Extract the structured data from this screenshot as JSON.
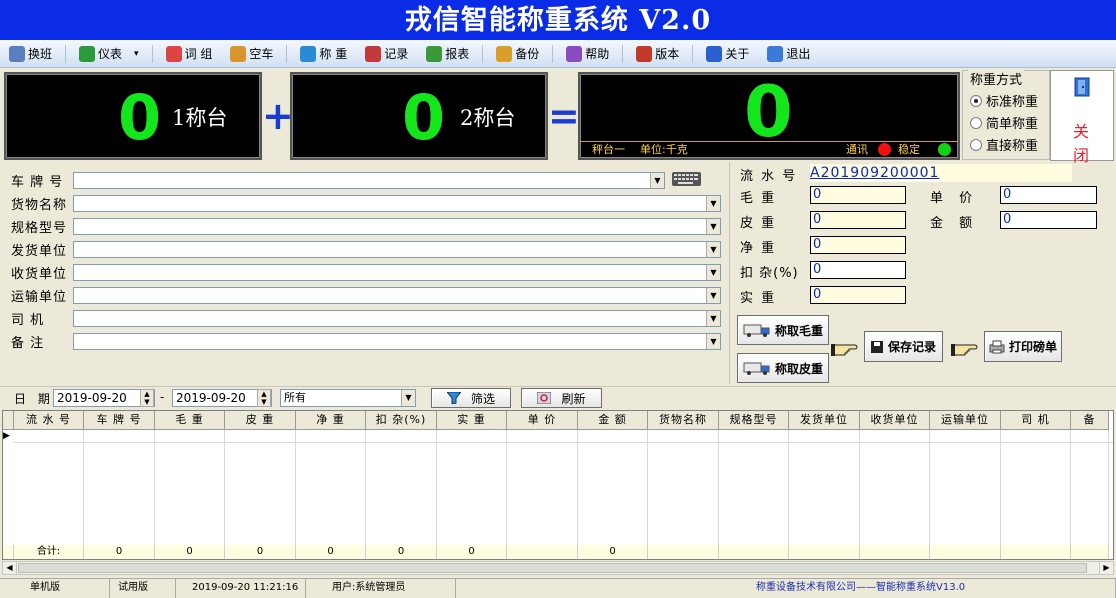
{
  "app": {
    "title": "戎信智能称重系统 V2.0"
  },
  "colors": {
    "title_bg": "#0b2ce6",
    "digit": "#14e61c",
    "accent_blue": "#1a3bd6",
    "close_red": "#e8202a"
  },
  "toolbar": {
    "items": [
      {
        "label": "换班",
        "icon": "user-icon"
      },
      {
        "label": "仪表",
        "icon": "gauge-icon"
      },
      {
        "label": "词 组",
        "icon": "edit-icon"
      },
      {
        "label": "空车",
        "icon": "truck-icon"
      },
      {
        "label": "称 重",
        "icon": "scale-icon"
      },
      {
        "label": "记录",
        "icon": "records-icon"
      },
      {
        "label": "报表",
        "icon": "report-icon"
      },
      {
        "label": "备份",
        "icon": "backup-icon"
      },
      {
        "label": "帮助",
        "icon": "help-icon"
      },
      {
        "label": "版本",
        "icon": "version-icon"
      },
      {
        "label": "关于",
        "icon": "info-icon"
      },
      {
        "label": "退出",
        "icon": "exit-icon"
      }
    ]
  },
  "display": {
    "scale1": {
      "value": "0",
      "label": "1称台"
    },
    "plus": "+",
    "scale2": {
      "value": "0",
      "label": "2称台"
    },
    "equals": "=",
    "total": {
      "value": "0",
      "platform": "秤台一",
      "unit": "单位:千克",
      "comm": "通讯",
      "stable": "稳定",
      "comm_color": "#ee1111",
      "stable_color": "#12d412"
    }
  },
  "weigh_mode": {
    "legend": "称重方式",
    "options": [
      "标准称重",
      "简单称重",
      "直接称重"
    ],
    "selected": "标准称重"
  },
  "close_button": {
    "label": "关闭"
  },
  "form_left": {
    "fields": [
      {
        "label": "车 牌 号",
        "value": ""
      },
      {
        "label": "货物名称",
        "value": ""
      },
      {
        "label": "规格型号",
        "value": ""
      },
      {
        "label": "发货单位",
        "value": ""
      },
      {
        "label": "收货单位",
        "value": ""
      },
      {
        "label": "运输单位",
        "value": ""
      },
      {
        "label": "司   机",
        "value": ""
      },
      {
        "label": "备   注",
        "value": ""
      }
    ]
  },
  "form_right": {
    "serial_label": "流 水 号",
    "serial_value": "A201909200001",
    "gross_label": "毛  重",
    "gross": "0",
    "tare_label": "皮  重",
    "tare": "0",
    "net_label": "净  重",
    "net": "0",
    "deduct_label": "扣 杂(%)",
    "deduct": "0",
    "actual_label": "实  重",
    "actual": "0",
    "price_label": "单  价",
    "price": "0",
    "amount_label": "金  额",
    "amount": "0"
  },
  "actions": {
    "gross_btn": "称取毛重",
    "tare_btn": "称取皮重",
    "save_btn": "保存记录",
    "print_btn": "打印磅单"
  },
  "filter": {
    "date_label": "日 期",
    "date_from": "2019-09-20",
    "dash": "-",
    "date_to": "2019-09-20",
    "select_value": "所有",
    "filter_btn": "筛选",
    "refresh_btn": "刷新"
  },
  "table": {
    "columns": [
      "流 水 号",
      "车 牌 号",
      "毛   重",
      "皮   重",
      "净   重",
      "扣 杂(%)",
      "实   重",
      "单   价",
      "金   额",
      "货物名称",
      "规格型号",
      "发货单位",
      "收货单位",
      "运输单位",
      "司   机",
      "备"
    ],
    "row_marker": "▶",
    "totals": [
      "合计:",
      "0",
      "0",
      "0",
      "0",
      "0",
      "0",
      "",
      "0",
      "",
      "",
      "",
      "",
      "",
      "",
      ""
    ]
  },
  "status": {
    "mode": "单机版",
    "license": "试用版",
    "datetime": "2019-09-20 11:21:16",
    "user": "用户:系统管理员",
    "company": "称重设备技术有限公司——智能称重系统V13.0"
  }
}
